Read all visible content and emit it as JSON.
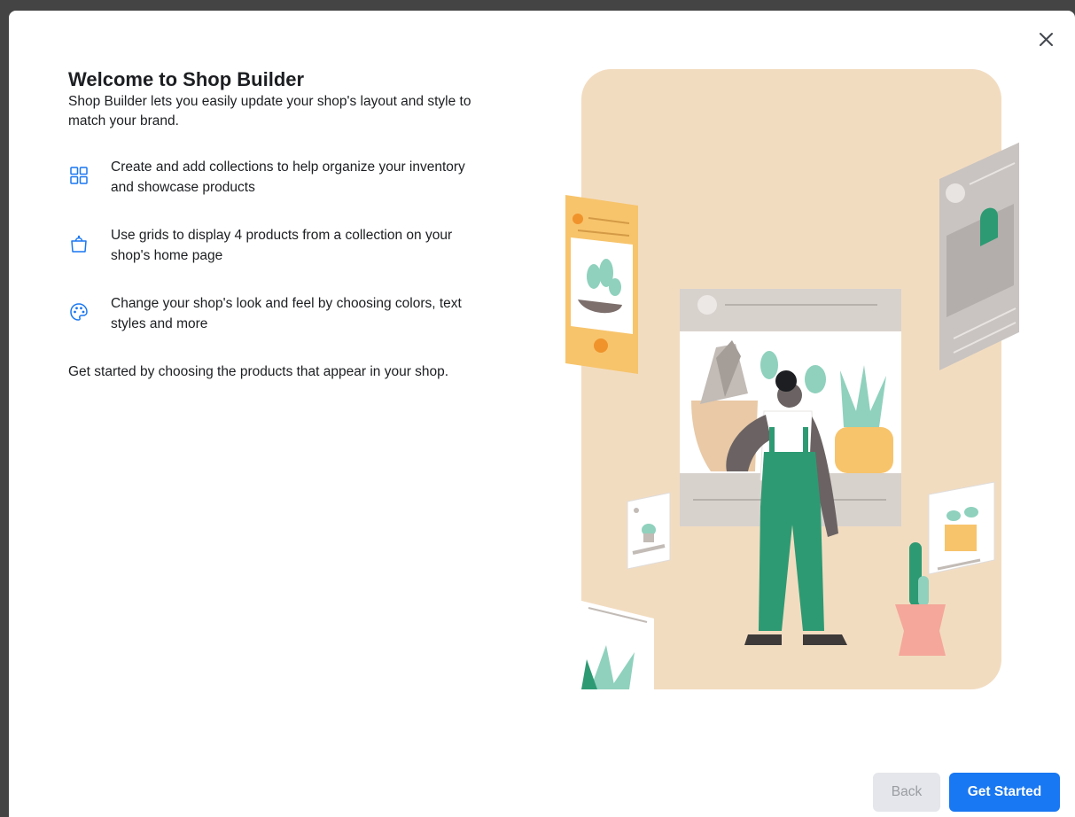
{
  "dialog": {
    "title": "Welcome to Shop Builder",
    "intro": "Shop Builder lets you easily update your shop's layout and style to match your brand.",
    "features": [
      {
        "icon": "grid-icon",
        "text": "Create and add collections to help organize your inventory and showcase products"
      },
      {
        "icon": "shopping-bag-icon",
        "text": "Use grids to display 4 products from a collection on your shop's home page"
      },
      {
        "icon": "palette-icon",
        "text": "Change your shop's look and feel by choosing colors, text styles and more"
      }
    ],
    "outro": "Get started by choosing the products that appear in your shop.",
    "close_icon": "close-icon"
  },
  "footer": {
    "back_label": "Back",
    "start_label": "Get Started"
  },
  "colors": {
    "accent": "#1877f2",
    "illustration_bg": "#f2dcc0",
    "overalls": "#2d9a73"
  }
}
